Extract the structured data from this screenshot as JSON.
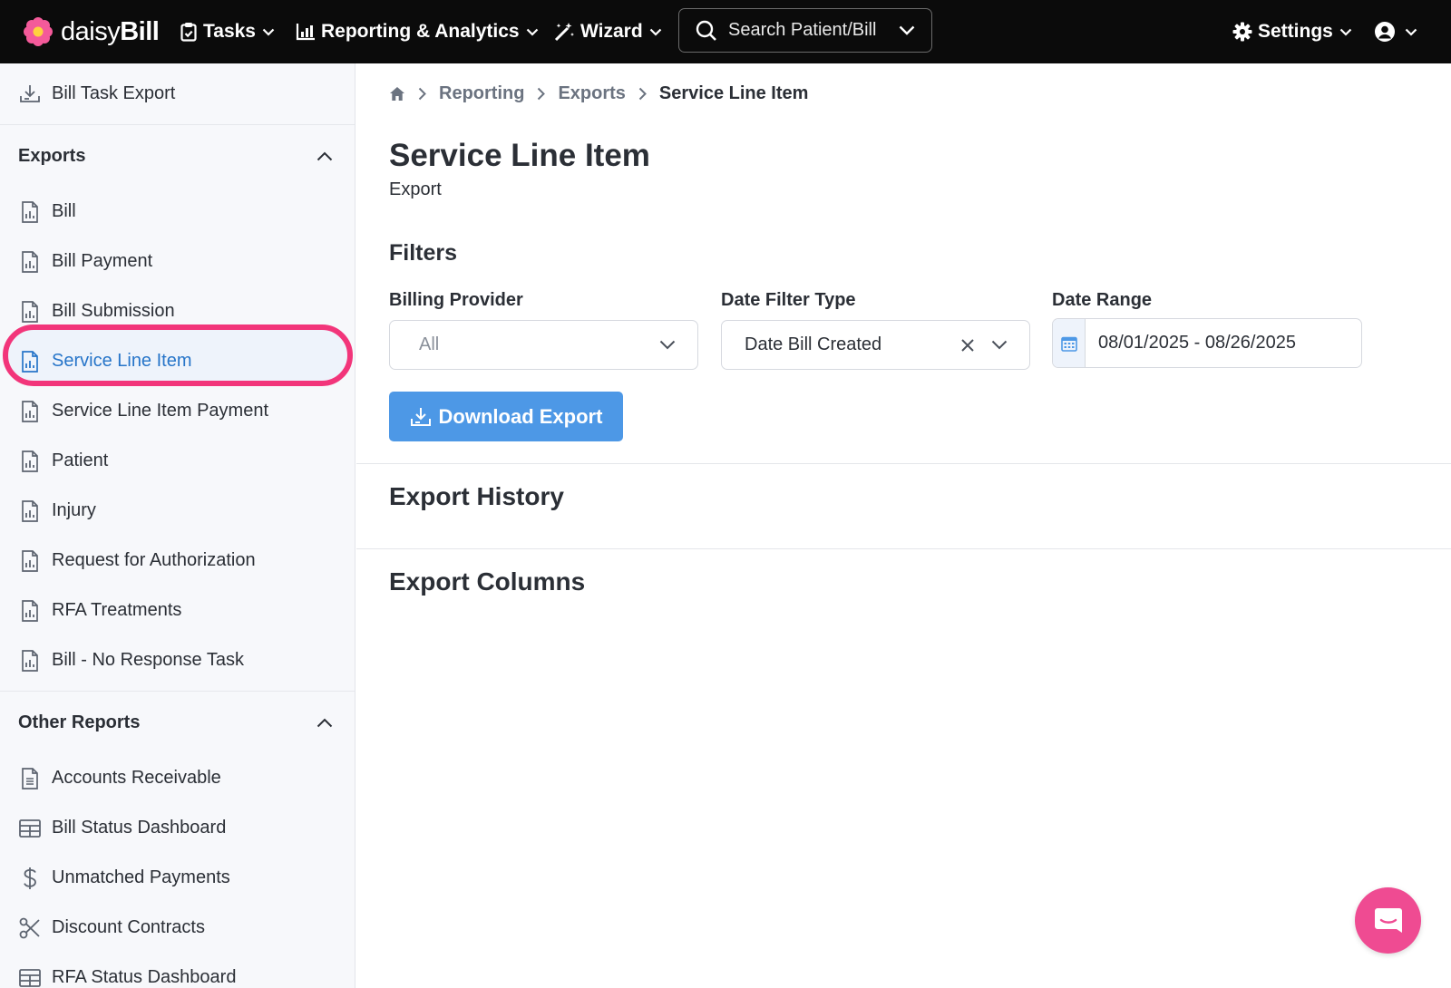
{
  "header": {
    "brand_light": "daisy",
    "brand_bold": "Bill",
    "nav": [
      {
        "label": "Tasks",
        "icon": "clipboard-check-icon"
      },
      {
        "label": "Reporting & Analytics",
        "icon": "bar-chart-icon"
      },
      {
        "label": "Wizard",
        "icon": "magic-wand-icon"
      }
    ],
    "search_label": "Search Patient/Bill",
    "settings_label": "Settings"
  },
  "sidebar": {
    "top_item": "Bill Task Export",
    "exports_title": "Exports",
    "exports": [
      {
        "label": "Bill"
      },
      {
        "label": "Bill Payment"
      },
      {
        "label": "Bill Submission"
      },
      {
        "label": "Service Line Item",
        "active": true
      },
      {
        "label": "Service Line Item Payment"
      },
      {
        "label": "Patient"
      },
      {
        "label": "Injury"
      },
      {
        "label": "Request for Authorization"
      },
      {
        "label": "RFA Treatments"
      },
      {
        "label": "Bill - No Response Task"
      }
    ],
    "other_title": "Other Reports",
    "other": [
      {
        "label": "Accounts Receivable",
        "icon": "document-icon"
      },
      {
        "label": "Bill Status Dashboard",
        "icon": "table-icon"
      },
      {
        "label": "Unmatched Payments",
        "icon": "dollar-icon"
      },
      {
        "label": "Discount Contracts",
        "icon": "scissors-icon"
      },
      {
        "label": "RFA Status Dashboard",
        "icon": "table-icon"
      }
    ]
  },
  "breadcrumb": {
    "items": [
      "Reporting",
      "Exports"
    ],
    "current": "Service Line Item"
  },
  "page": {
    "title": "Service Line Item",
    "subtitle": "Export",
    "filters_title": "Filters",
    "billing_provider": {
      "label": "Billing Provider",
      "value": "All"
    },
    "date_filter_type": {
      "label": "Date Filter Type",
      "value": "Date Bill Created"
    },
    "date_range": {
      "label": "Date Range",
      "value": "08/01/2025 - 08/26/2025"
    },
    "download_label": "Download Export",
    "export_history": "Export History",
    "export_columns": "Export Columns"
  },
  "colors": {
    "accent": "#2775c9",
    "button": "#4d98e6",
    "highlight": "#f2357a",
    "chat": "#ef4b92"
  }
}
